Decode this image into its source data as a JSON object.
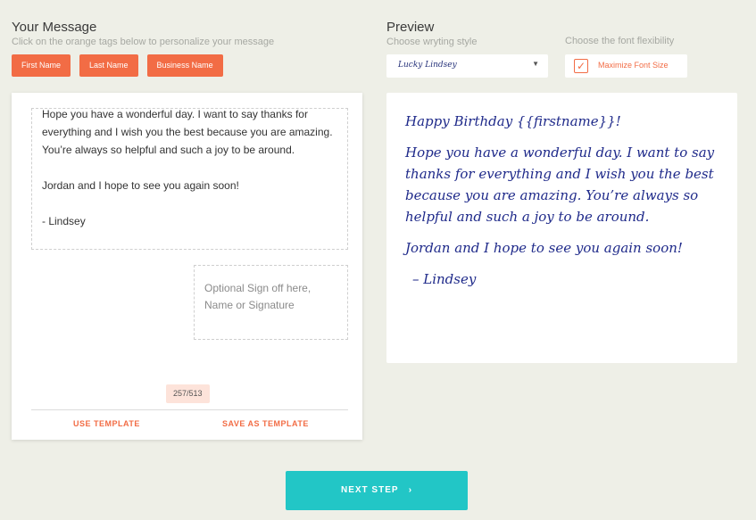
{
  "message_section": {
    "title": "Your Message",
    "subtitle": "Click on the orange tags below to personalize your message",
    "tags": [
      "First Name",
      "Last Name",
      "Business Name"
    ]
  },
  "preview_section": {
    "title": "Preview",
    "style_label": "Choose wryting style",
    "flex_label": "Choose the font flexibility",
    "style_value": "Lucky Lindsey",
    "maximize_label": "Maximize Font Size",
    "maximize_checked": true
  },
  "editor": {
    "lines": [
      "Hope you have a wonderful day. I want to say thanks for everything and I wish you the best because you are amazing. You’re always so helpful and such a joy to be around.",
      "Jordan and I hope to see you again soon!",
      " - Lindsey"
    ],
    "signoff_placeholder": "Optional Sign off here, Name or Signature",
    "counter": "257/513",
    "use_template": "USE TEMPLATE",
    "save_template": "SAVE AS TEMPLATE"
  },
  "preview": {
    "greeting": "Happy Birthday {{firstname}}!",
    "body": "Hope you have a wonderful day. I want to say thanks for everything and I wish you the best because you are amazing. You’re always so helpful and such a joy to be around.",
    "closing": "Jordan and I hope to see you again soon!",
    "signature": "– Lindsey"
  },
  "next_button": "NEXT STEP",
  "next_icon": "chevron-right-icon",
  "colors": {
    "accent": "#f26c45",
    "teal": "#22c6c6",
    "ink": "#1f2a8a",
    "background": "#eeefe7"
  }
}
